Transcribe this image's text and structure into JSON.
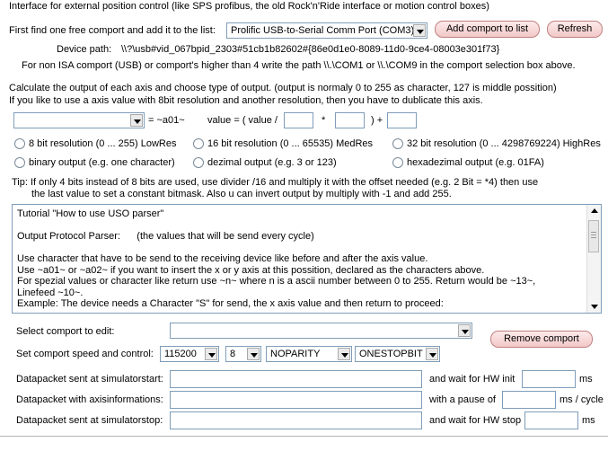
{
  "header": {
    "intro": "Interface for external position control (like SPS profibus,  the old Rock'n'Ride interface or motion control boxes)"
  },
  "comport_select": {
    "label": "First find one free comport and add it to the list:",
    "value": "Prolific USB-to-Serial Comm Port (COM3)",
    "add_button": "Add comport to list",
    "refresh_button": "Refresh"
  },
  "device_path": {
    "label": "Device path:",
    "value": "\\\\?\\usb#vid_067bpid_2303#51cb1b82602#{86e0d1e0-8089-11d0-9ce4-08003e301f73}",
    "note": "For non ISA comport (USB) or comport's higher than 4 write the path \\\\.\\COM1 or \\\\.\\COM9 in the comport selection box above."
  },
  "axis_desc": {
    "line1": "Calculate the output of each axis and choose type of output. (output is normaly 0 to 255 as character, 127 is middle possition)",
    "line2": "If you like to use a axis value with 8bit resolution and another resolution, then you have to dublicate this axis."
  },
  "formula": {
    "axis_value": "",
    "token": "= ~a01~",
    "value_label": "value = ( value /",
    "mult_sign": "*",
    "plus_sign": ") +"
  },
  "resolution_options": [
    "8 bit resolution (0 ... 255) LowRes",
    "16 bit resolution (0 ... 65535) MedRes",
    "32 bit resolution (0 ... 4298769224) HighRes"
  ],
  "output_options": [
    "binary output (e.g. one character)",
    "dezimal output (e.g. 3 or 123)",
    "hexadezimal output (e.g. 01FA)"
  ],
  "tip": {
    "line1": "Tip: If only 4 bits instead of 8 bits are used, use divider /16 and multiply it with the offset needed (e.g. 2 Bit = *4) then use",
    "line2": "the last value to set a constant bitmask. Also u can invert output by multiply with -1 and add 255."
  },
  "tutorial": {
    "text": "Tutorial \"How to use USO parser\"\n\nOutput Protocol Parser:      (the values that will be send every cycle)\n\nUse character that have to be send to the receiving device like before and after the axis value.\nUse ~a01~ or ~a02~ if you want to insert the x or y axis at this possition, declared as the characters above.\nFor spezial values or character like return use ~n~ where n is a ascii number between 0 to 255. Return would be ~13~,\nLinefeed ~10~.\nExample: The device needs a Character \"S\" for send, the x axis value and then return to proceed:"
  },
  "edit_comport": {
    "label": "Select comport  to edit:",
    "value": "",
    "remove_button": "Remove comport"
  },
  "speed_control": {
    "label": "Set comport speed and control:",
    "baud": "115200",
    "databits": "8",
    "parity": "NOPARITY",
    "stopbits": "ONESTOPBIT"
  },
  "packets": {
    "start_label": "Datapacket sent at simulatorstart:",
    "axis_label": "Datapacket with axisinformations:",
    "stop_label": "Datapacket sent at simulatorstop:",
    "start_wait_label": "and wait for HW init",
    "axis_pause_label": "with a pause of",
    "stop_wait_label": "and wait for HW stop",
    "ms": "ms",
    "ms_cycle": "ms / cycle"
  }
}
